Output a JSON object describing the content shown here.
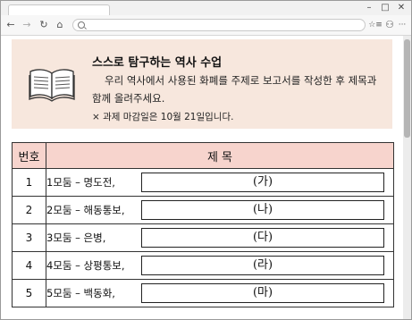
{
  "browser": {
    "nav_back": "←",
    "nav_forward": "→",
    "nav_reload": "↻",
    "nav_home": "⌂",
    "btn_minimize": "–",
    "btn_maximize": "□",
    "btn_close": "✕",
    "btn_favorites": "☆≡",
    "btn_account": "⚇",
    "btn_more": "···"
  },
  "banner": {
    "title": "스스로 탐구하는 역사 수업",
    "body": "우리 역사에서 사용된 화폐를 주제로 보고서를 작성한 후 제목과 함께 올려주세요.",
    "note": "× 과제 마감일은 10월 21일입니다."
  },
  "table": {
    "header_num": "번호",
    "header_title": "제  목",
    "rows": [
      {
        "num": "1",
        "label": "1모둠 – 명도전,",
        "blank": "(가)"
      },
      {
        "num": "2",
        "label": "2모둠 – 해동통보,",
        "blank": "(나)"
      },
      {
        "num": "3",
        "label": "3모둠 – 은병,",
        "blank": "(다)"
      },
      {
        "num": "4",
        "label": "4모둠 – 상평통보,",
        "blank": "(라)"
      },
      {
        "num": "5",
        "label": "5모둠 – 백동화,",
        "blank": "(마)"
      }
    ]
  },
  "colors": {
    "banner_bg": "#f7e7dd",
    "header_bg": "#f7d4cd"
  }
}
